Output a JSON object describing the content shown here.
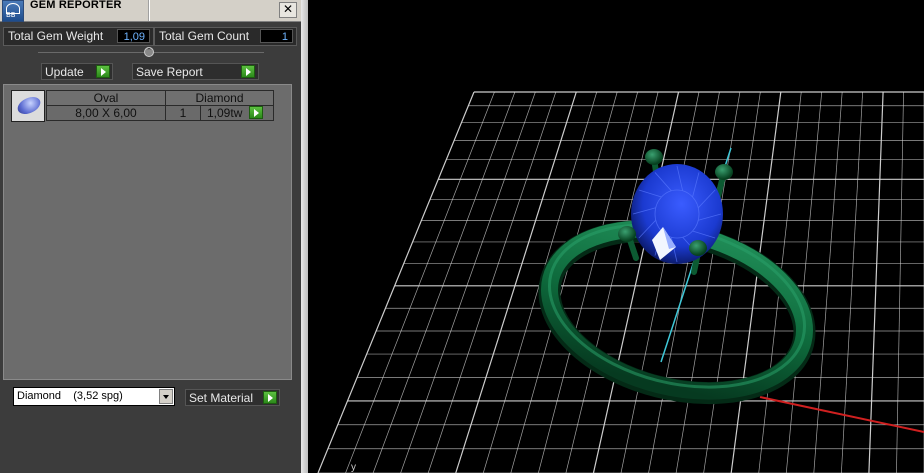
{
  "window": {
    "title": "GEM REPORTER",
    "close_glyph": "✕"
  },
  "stats": {
    "weight_label": "Total Gem Weight",
    "weight_value": "1,09",
    "count_label": "Total Gem Count",
    "count_value": "1"
  },
  "buttons": {
    "update": "Update",
    "save_report": "Save Report",
    "set_material": "Set Material"
  },
  "gem_row": {
    "shape": "Oval",
    "type": "Diamond",
    "size": "8,00 X 6,00",
    "qty": "1",
    "weight": "1,09tw"
  },
  "material_select": {
    "selected": "Diamond    (3,52 spg)"
  },
  "viewport": {
    "axis_label": "y"
  },
  "icons": {
    "app": "gem-reporter-logo-icon",
    "close": "close-icon",
    "collapse": "collapse-knob-icon",
    "play": "play-arrow-icon",
    "gem": "oval-gem-icon",
    "dropdown": "chevron-down-icon"
  },
  "colors": {
    "grid": "#d8d8d8",
    "axis_y": "#3fc8d8",
    "axis_x": "#d02020",
    "band": "#0e6a3c",
    "gem": "#1b3ad0",
    "accent_green": "#3aa02a",
    "value_text": "#6fb4ff"
  }
}
